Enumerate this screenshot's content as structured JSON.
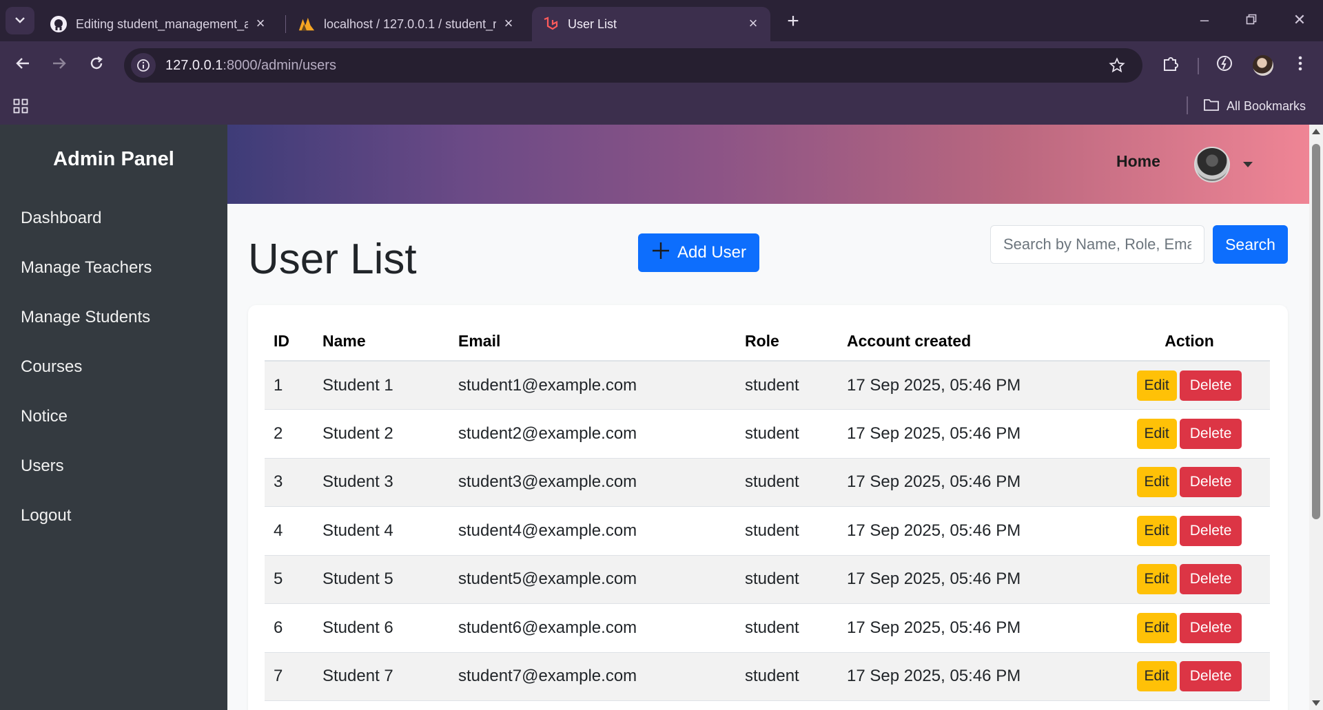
{
  "browser": {
    "tabs": [
      {
        "title": "Editing student_management_a",
        "icon": "github-icon"
      },
      {
        "title": "localhost / 127.0.0.1 / student_r",
        "icon": "phpmyadmin-icon"
      },
      {
        "title": "User List",
        "icon": "laravel-icon",
        "active": true
      }
    ],
    "url_host": "127.0.0.1",
    "url_rest": ":8000/admin/users",
    "all_bookmarks_label": "All Bookmarks"
  },
  "sidebar": {
    "brand": "Admin Panel",
    "items": [
      {
        "label": "Dashboard"
      },
      {
        "label": "Manage Teachers"
      },
      {
        "label": "Manage Students"
      },
      {
        "label": "Courses"
      },
      {
        "label": "Notice"
      },
      {
        "label": "Users"
      },
      {
        "label": "Logout"
      }
    ]
  },
  "header": {
    "home_label": "Home"
  },
  "main": {
    "title": "User List",
    "add_button_label": "Add User",
    "search_placeholder": "Search by Name, Role, Email",
    "search_button_label": "Search"
  },
  "table": {
    "headers": {
      "id": "ID",
      "name": "Name",
      "email": "Email",
      "role": "Role",
      "created": "Account created",
      "action": "Action"
    },
    "edit_label": "Edit",
    "delete_label": "Delete",
    "rows": [
      {
        "id": "1",
        "name": "Student 1",
        "email": "student1@example.com",
        "role": "student",
        "created": "17 Sep 2025, 05:46 PM"
      },
      {
        "id": "2",
        "name": "Student 2",
        "email": "student2@example.com",
        "role": "student",
        "created": "17 Sep 2025, 05:46 PM"
      },
      {
        "id": "3",
        "name": "Student 3",
        "email": "student3@example.com",
        "role": "student",
        "created": "17 Sep 2025, 05:46 PM"
      },
      {
        "id": "4",
        "name": "Student 4",
        "email": "student4@example.com",
        "role": "student",
        "created": "17 Sep 2025, 05:46 PM"
      },
      {
        "id": "5",
        "name": "Student 5",
        "email": "student5@example.com",
        "role": "student",
        "created": "17 Sep 2025, 05:46 PM"
      },
      {
        "id": "6",
        "name": "Student 6",
        "email": "student6@example.com",
        "role": "student",
        "created": "17 Sep 2025, 05:46 PM"
      },
      {
        "id": "7",
        "name": "Student 7",
        "email": "student7@example.com",
        "role": "student",
        "created": "17 Sep 2025, 05:46 PM"
      }
    ]
  },
  "colors": {
    "sidebar_bg": "#343a40",
    "primary": "#0d6efd",
    "warning": "#ffc107",
    "danger": "#dc3545"
  }
}
